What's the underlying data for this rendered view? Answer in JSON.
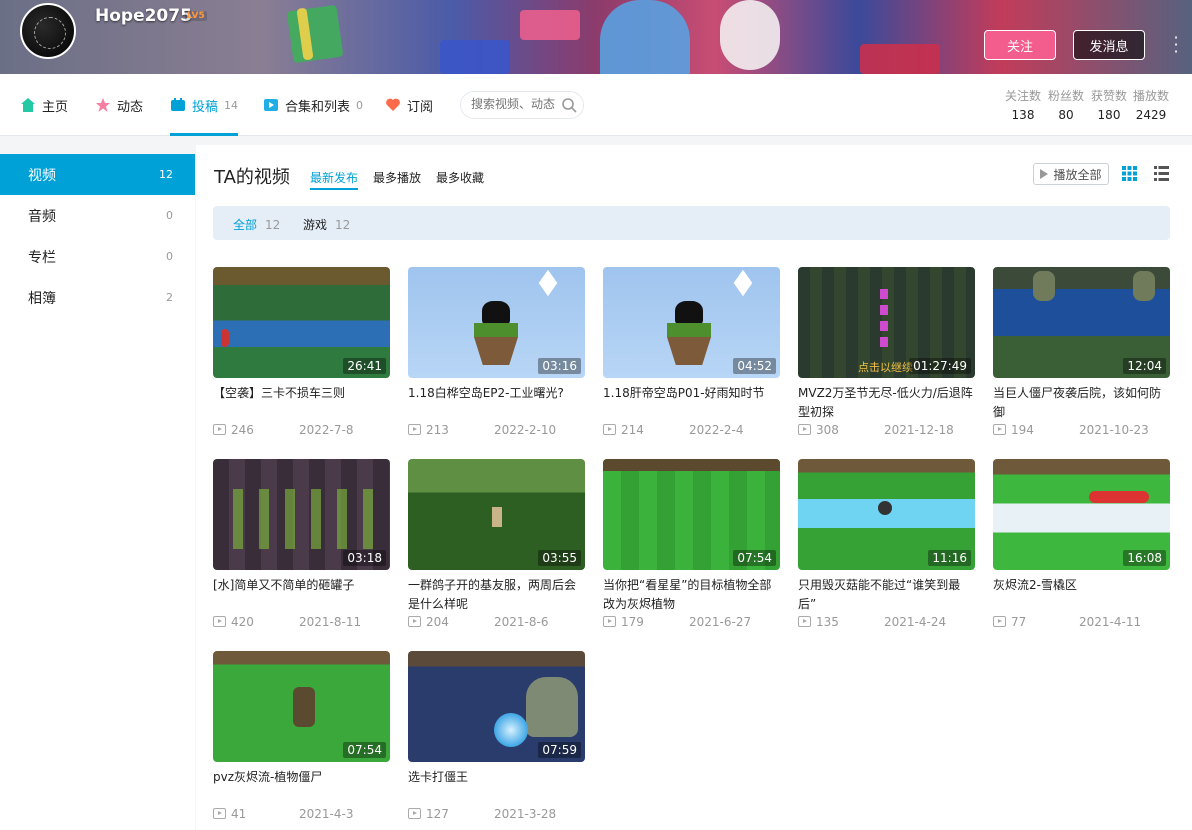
{
  "profile": {
    "username": "Hope2075",
    "level_badge": "LV5",
    "follow_label": "关注",
    "message_label": "发消息"
  },
  "nav": {
    "items": [
      {
        "label": "主页",
        "count": ""
      },
      {
        "label": "动态",
        "count": ""
      },
      {
        "label": "投稿",
        "count": "14"
      },
      {
        "label": "合集和列表",
        "count": "0"
      },
      {
        "label": "订阅",
        "count": ""
      }
    ],
    "search_placeholder": "搜索视频、动态",
    "stats": [
      {
        "label": "关注数",
        "value": "138"
      },
      {
        "label": "粉丝数",
        "value": "80"
      },
      {
        "label": "获赞数",
        "value": "180"
      },
      {
        "label": "播放数",
        "value": "2429"
      }
    ]
  },
  "sidebar": {
    "items": [
      {
        "label": "视频",
        "count": "12"
      },
      {
        "label": "音频",
        "count": "0"
      },
      {
        "label": "专栏",
        "count": "0"
      },
      {
        "label": "相簿",
        "count": "2"
      }
    ]
  },
  "main": {
    "title": "TA的视频",
    "sorts": [
      "最新发布",
      "最多播放",
      "最多收藏"
    ],
    "play_all_label": "播放全部",
    "filters": [
      {
        "label": "全部",
        "count": "12"
      },
      {
        "label": "游戏",
        "count": "12"
      }
    ]
  },
  "videos": [
    {
      "title": "【空袭】三卡不损车三则",
      "duration": "26:41",
      "plays": "246",
      "date": "2022-7-8"
    },
    {
      "title": "1.18白桦空岛EP2-工业曙光?",
      "duration": "03:16",
      "plays": "213",
      "date": "2022-2-10"
    },
    {
      "title": "1.18肝帝空岛P01-好雨知时节",
      "duration": "04:52",
      "plays": "214",
      "date": "2022-2-4"
    },
    {
      "title": "MVZ2万圣节无尽-低火力/后退阵型初探",
      "duration": "01:27:49",
      "plays": "308",
      "date": "2021-12-18"
    },
    {
      "title": "当巨人僵尸夜袭后院，该如何防御",
      "duration": "12:04",
      "plays": "194",
      "date": "2021-10-23"
    },
    {
      "title": "[水]简单又不简单的砸罐子",
      "duration": "03:18",
      "plays": "420",
      "date": "2021-8-11"
    },
    {
      "title": "一群鸽子开的基友服，两周后会是什么样呢",
      "duration": "03:55",
      "plays": "204",
      "date": "2021-8-6"
    },
    {
      "title": "当你把“看星星”的目标植物全部改为灰烬植物",
      "duration": "07:54",
      "plays": "179",
      "date": "2021-6-27"
    },
    {
      "title": "只用毁灭菇能不能过“谁笑到最后”",
      "duration": "11:16",
      "plays": "135",
      "date": "2021-4-24"
    },
    {
      "title": "灰烬流2-雪橇区",
      "duration": "16:08",
      "plays": "77",
      "date": "2021-4-11"
    },
    {
      "title": "pvz灰烬流-植物僵尸",
      "duration": "07:54",
      "plays": "41",
      "date": "2021-4-3"
    },
    {
      "title": "选卡打僵王",
      "duration": "07:59",
      "plays": "127",
      "date": "2021-3-28"
    }
  ],
  "thumb_overlays": {
    "mvz2_caption": "点击以继续"
  },
  "colors": {
    "accent": "#00a1d6",
    "follow_pink": "#f25d8e"
  }
}
